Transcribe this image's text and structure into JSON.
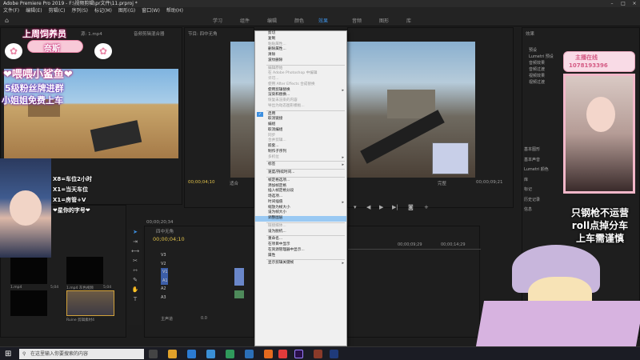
{
  "window": {
    "title": "Adobe Premiere Pro 2019 - F:\\视频剪辑\\pr文件\\11.prproj *"
  },
  "menu": [
    "文件(F)",
    "编辑(E)",
    "剪辑(C)",
    "序列(S)",
    "标记(M)",
    "图形(G)",
    "窗口(W)",
    "帮助(H)"
  ],
  "workspaces": [
    "学习",
    "组件",
    "编辑",
    "颜色",
    "效果",
    "音频",
    "图形",
    "库"
  ],
  "active_workspace": "效果",
  "source_panel": {
    "tab": "源: 1.mp4",
    "tab2": "音频剪辑混合器"
  },
  "program_panel": {
    "tab": "节目: 四中无角",
    "timecode_left": "00;00;04;10",
    "fit_label": "适合",
    "quality": "完整",
    "timecode_right": "00;00;09;21",
    "source_timecode": "00;00;20;34"
  },
  "timeline_panel": {
    "tab": "四中无角",
    "timecode": "00;00;04;10",
    "ruler": [
      "00;00;09;29",
      "00;00;14;29"
    ],
    "tracks": [
      "V3",
      "V2",
      "V1",
      "A1",
      "A2",
      "A3"
    ],
    "master": "主声道",
    "master_value": "0.0"
  },
  "project_panel": {
    "items": [
      {
        "name": "1.mp4",
        "duration": "5;04"
      },
      {
        "name": "1.mp4 灰色视频",
        "duration": "5;04"
      },
      {
        "name": "Ruine 剪辑素材4",
        "duration": "5;04"
      }
    ]
  },
  "effects_panel": {
    "tab": "效果",
    "items": [
      "预设",
      "Lumetri 预设",
      "音频效果",
      "音频过渡",
      "视频效果",
      "视频过渡"
    ],
    "sections": [
      "基本图形",
      "基本声音",
      "Lumetri 颜色",
      "库",
      "标记",
      "历史记录",
      "信息"
    ]
  },
  "context_menu": {
    "items": [
      {
        "label": "剪切",
        "state": "normal"
      },
      {
        "label": "复制",
        "state": "normal"
      },
      {
        "label": "粘贴属性...",
        "state": "disabled"
      },
      {
        "label": "删除属性...",
        "state": "normal"
      },
      {
        "label": "清除",
        "state": "normal"
      },
      {
        "label": "波纹删除",
        "state": "normal"
      },
      {
        "label": "",
        "state": "separator"
      },
      {
        "label": "编辑原始",
        "state": "disabled"
      },
      {
        "label": "在 Adobe Photoshop 中编辑",
        "state": "disabled"
      },
      {
        "label": "许可...",
        "state": "disabled"
      },
      {
        "label": "使用 After Effects 合成替换",
        "state": "disabled"
      },
      {
        "label": "使用剪辑替换",
        "state": "normal",
        "submenu": true
      },
      {
        "label": "渲染和替换...",
        "state": "normal"
      },
      {
        "label": "恢复未渲染的内容",
        "state": "disabled"
      },
      {
        "label": "导出为动态图形模板...",
        "state": "disabled"
      },
      {
        "label": "",
        "state": "separator"
      },
      {
        "label": "启用",
        "state": "checked"
      },
      {
        "label": "取消链接",
        "state": "normal"
      },
      {
        "label": "编组",
        "state": "normal"
      },
      {
        "label": "取消编组",
        "state": "normal"
      },
      {
        "label": "同步",
        "state": "disabled"
      },
      {
        "label": "合并剪辑...",
        "state": "disabled"
      },
      {
        "label": "嵌套...",
        "state": "normal"
      },
      {
        "label": "制作子序列",
        "state": "normal"
      },
      {
        "label": "多机位",
        "state": "disabled",
        "submenu": true
      },
      {
        "label": "",
        "state": "separator"
      },
      {
        "label": "标签",
        "state": "normal",
        "submenu": true
      },
      {
        "label": "",
        "state": "separator"
      },
      {
        "label": "速度/持续时间...",
        "state": "normal"
      },
      {
        "label": "",
        "state": "separator"
      },
      {
        "label": "帧定格选项...",
        "state": "normal"
      },
      {
        "label": "添加帧定格",
        "state": "normal"
      },
      {
        "label": "插入帧定格分段",
        "state": "normal"
      },
      {
        "label": "场选项...",
        "state": "normal"
      },
      {
        "label": "时间插值",
        "state": "normal",
        "submenu": true
      },
      {
        "label": "缩放为帧大小",
        "state": "normal"
      },
      {
        "label": "设为帧大小",
        "state": "normal"
      },
      {
        "label": "调整图层",
        "state": "highlighted"
      },
      {
        "label": "",
        "state": "separator"
      },
      {
        "label": "链接媒体...",
        "state": "disabled"
      },
      {
        "label": "设为脱机...",
        "state": "normal"
      },
      {
        "label": "",
        "state": "separator"
      },
      {
        "label": "重命名...",
        "state": "normal"
      },
      {
        "label": "在项目中显示",
        "state": "normal"
      },
      {
        "label": "在资源管理器中显示...",
        "state": "normal"
      },
      {
        "label": "属性",
        "state": "normal"
      },
      {
        "label": "",
        "state": "separator"
      },
      {
        "label": "显示剪辑关键帧",
        "state": "normal",
        "submenu": true
      }
    ]
  },
  "stream_overlay": {
    "header": "上周饲养员",
    "name": "奈斯",
    "slogan": "❤喂喂小鲨鱼❤",
    "line1": "5级粉丝牌进群",
    "line2": "小姐姐免费上车",
    "rules": [
      "X8=车位2小时",
      "X1=当天车位",
      "X1=房管+V",
      "❤星你的字号❤"
    ],
    "right_badge_top": "主播在线",
    "right_badge_num": "1078193396",
    "right_text": [
      "只钢枪不运营",
      "roll点掉分车",
      "上车需谨慎"
    ]
  },
  "taskbar": {
    "search_placeholder": "在这里输入你要搜索的内容"
  }
}
